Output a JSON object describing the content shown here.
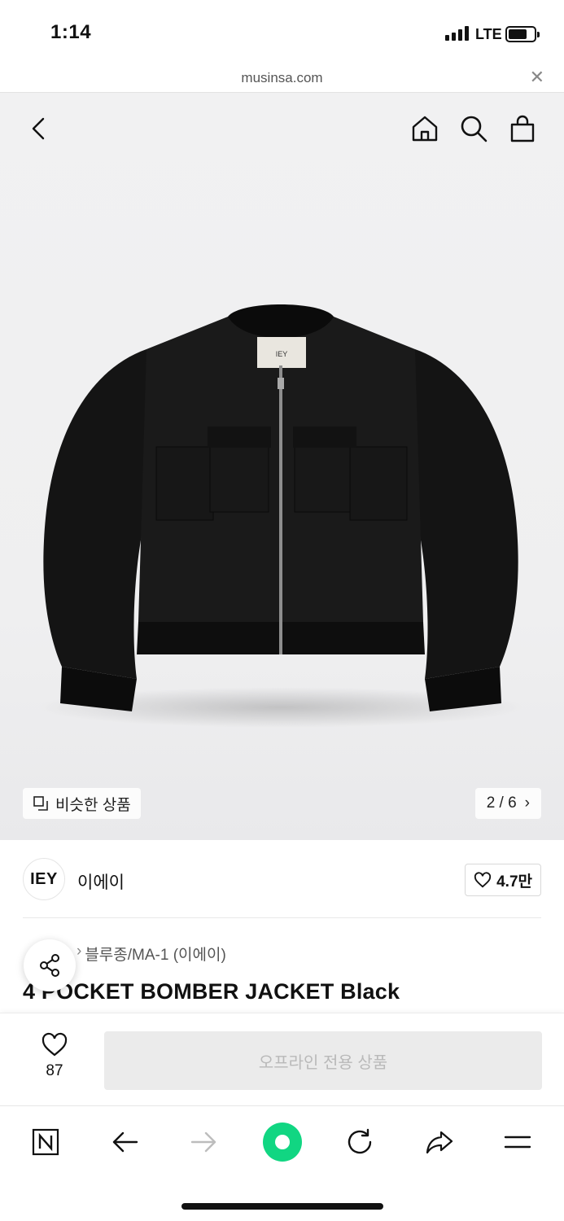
{
  "status_bar": {
    "time": "1:14",
    "network": "LTE",
    "battery_level": 0.72
  },
  "browser": {
    "url": "musinsa.com"
  },
  "header_icons": [
    "back-icon",
    "home-icon",
    "search-icon",
    "bag-icon"
  ],
  "gallery": {
    "similar_label": "비슷한 상품",
    "counter": "2 / 6",
    "brand_tag": "IEY"
  },
  "brand": {
    "logo_text": "IEY",
    "name": "이에이",
    "likes": "4.7만"
  },
  "product": {
    "category": "블루종/MA-1 (이에이)",
    "title": "4 POCKET BOMBER JACKET Black"
  },
  "purchase_bar": {
    "wish_count": "87",
    "button_label": "오프라인 전용 상품"
  },
  "colors": {
    "accent_green": "#11d682",
    "disabled_bg": "#ebebeb",
    "disabled_text": "#b9b9b9"
  },
  "toolbar_icons": [
    "naver-n-icon",
    "back-arrow-icon",
    "forward-arrow-icon",
    "green-dot-icon",
    "refresh-icon",
    "share-arrow-icon",
    "menu-icon"
  ]
}
